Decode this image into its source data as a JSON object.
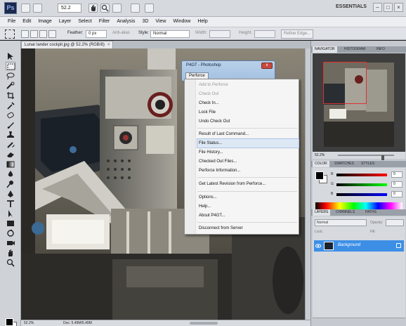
{
  "app": {
    "zoom_field": "52.2",
    "workspace": "ESSENTIALS",
    "window_controls": [
      "–",
      "□",
      "×"
    ]
  },
  "menubar": [
    "File",
    "Edit",
    "Image",
    "Layer",
    "Select",
    "Filter",
    "Analysis",
    "3D",
    "View",
    "Window",
    "Help"
  ],
  "options": {
    "feather_label": "Feather:",
    "feather_value": "0 px",
    "antialias_label": "Anti-alias",
    "style_label": "Style:",
    "style_value": "Normal",
    "width_label": "Width:",
    "height_label": "Height:",
    "refine_edge": "Refine Edge..."
  },
  "document": {
    "tab_title": "Lunar lander cockpit.jpg @ 52.2% (RGB/8)",
    "tab_close": "×",
    "status_zoom": "52.2%",
    "status_doc": "Doc: 5.49M/5.49M"
  },
  "dialog": {
    "title": "P4GT - Photoshop",
    "close": "x",
    "menu_button": "Perforce"
  },
  "context_menu": [
    {
      "label": "Add to Perforce",
      "disabled": true
    },
    {
      "label": "Check Out",
      "disabled": true
    },
    {
      "label": "Check In...",
      "disabled": false
    },
    {
      "label": "Lock File",
      "disabled": false
    },
    {
      "label": "Undo Check Out",
      "disabled": false
    },
    {
      "label": "Result of Last Command...",
      "disabled": false
    },
    {
      "label": "File Status...",
      "disabled": false,
      "highlighted": true
    },
    {
      "label": "File History...",
      "disabled": false
    },
    {
      "label": "Checked Out Files...",
      "disabled": false
    },
    {
      "label": "Perforce Information...",
      "disabled": false
    },
    {
      "label": "Get Latest Revision from Perforce...",
      "disabled": false
    },
    {
      "label": "Options...",
      "disabled": false
    },
    {
      "label": "Help...",
      "disabled": false
    },
    {
      "label": "About P4GT...",
      "disabled": false
    },
    {
      "label": "Disconnect from Server",
      "disabled": false
    }
  ],
  "panels": {
    "navigator_tabs": [
      "NAVIGATOR",
      "HISTOGRAM",
      "INFO"
    ],
    "navigator_zoom": "52.2%",
    "color_tabs": [
      "COLOR",
      "SWATCHES",
      "STYLES"
    ],
    "color_rows": [
      {
        "channel": "R",
        "value": "0",
        "color": "#ff0000"
      },
      {
        "channel": "G",
        "value": "0",
        "color": "#00ff00"
      },
      {
        "channel": "B",
        "value": "0",
        "color": "#0000ff"
      }
    ],
    "layers_tabs": [
      "LAYERS",
      "CHANNELS",
      "PATHS"
    ],
    "blend_mode": "Normal",
    "opacity_label": "Opacity:",
    "lock_label": "Lock:",
    "fill_label": "Fill:",
    "layer_name": "Background"
  },
  "colors": {
    "highlight": "#3d8fe6",
    "dialog_title_bar": "#a3c0e0",
    "close_button": "#c7493e"
  }
}
